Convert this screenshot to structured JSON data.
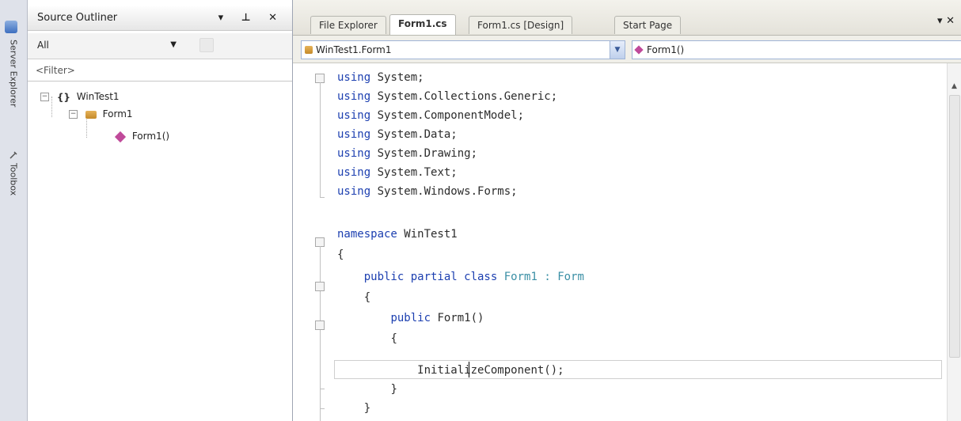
{
  "side_strip": {
    "tabs": [
      {
        "label": "Server Explorer",
        "icon": "server-explorer-icon"
      },
      {
        "label": "Toolbox",
        "icon": "toolbox-icon"
      }
    ]
  },
  "outliner": {
    "title": "Source Outliner",
    "title_buttons": "▾ ⊥ ✕",
    "scope": {
      "value": "All"
    },
    "filter_placeholder": "<Filter>",
    "tree": [
      {
        "label": "WinTest1",
        "kind": "namespace",
        "icon_glyph": "{}",
        "expanded": true
      },
      {
        "label": "Form1",
        "kind": "class",
        "expanded": true
      },
      {
        "label": "Form1()",
        "kind": "method"
      }
    ]
  },
  "editor": {
    "tabs": [
      {
        "label": "File Explorer",
        "active": false
      },
      {
        "label": "Form1.cs",
        "active": true
      },
      {
        "label": "Form1.cs [Design]",
        "active": false
      },
      {
        "label": "Start Page",
        "active": false
      }
    ],
    "close_glyph": "▾ ✕",
    "nav": {
      "class_combo": "WinTest1.Form1",
      "member_combo": "Form1()"
    },
    "code_lines": [
      {
        "indent": "",
        "kw": "using",
        "text": " System;"
      },
      {
        "indent": "",
        "kw": "using",
        "text": " System.Collections.Generic;"
      },
      {
        "indent": "",
        "kw": "using",
        "text": " System.ComponentModel;"
      },
      {
        "indent": "",
        "kw": "using",
        "text": " System.Data;"
      },
      {
        "indent": "",
        "kw": "using",
        "text": " System.Drawing;"
      },
      {
        "indent": "",
        "kw": "using",
        "text": " System.Text;"
      },
      {
        "indent": "",
        "kw": "using",
        "text": " System.Windows.Forms;"
      },
      {
        "indent": "",
        "kw": "",
        "text": ""
      },
      {
        "indent": "",
        "kw": "namespace",
        "text": " WinTest1"
      },
      {
        "indent": "",
        "kw": "",
        "text": "{"
      },
      {
        "indent": "    ",
        "kw": "public partial class",
        "text": " ",
        "type1": "Form1",
        "mid": " : ",
        "type2": "Form"
      },
      {
        "indent": "    ",
        "kw": "",
        "text": "{"
      },
      {
        "indent": "        ",
        "kw": "public",
        "text": " Form1()"
      },
      {
        "indent": "        ",
        "kw": "",
        "text": "{"
      },
      {
        "indent": "            ",
        "kw": "",
        "text": "InitializeComponent();"
      },
      {
        "indent": "        ",
        "kw": "",
        "text": "}"
      },
      {
        "indent": "    ",
        "kw": "",
        "text": "}"
      }
    ]
  }
}
